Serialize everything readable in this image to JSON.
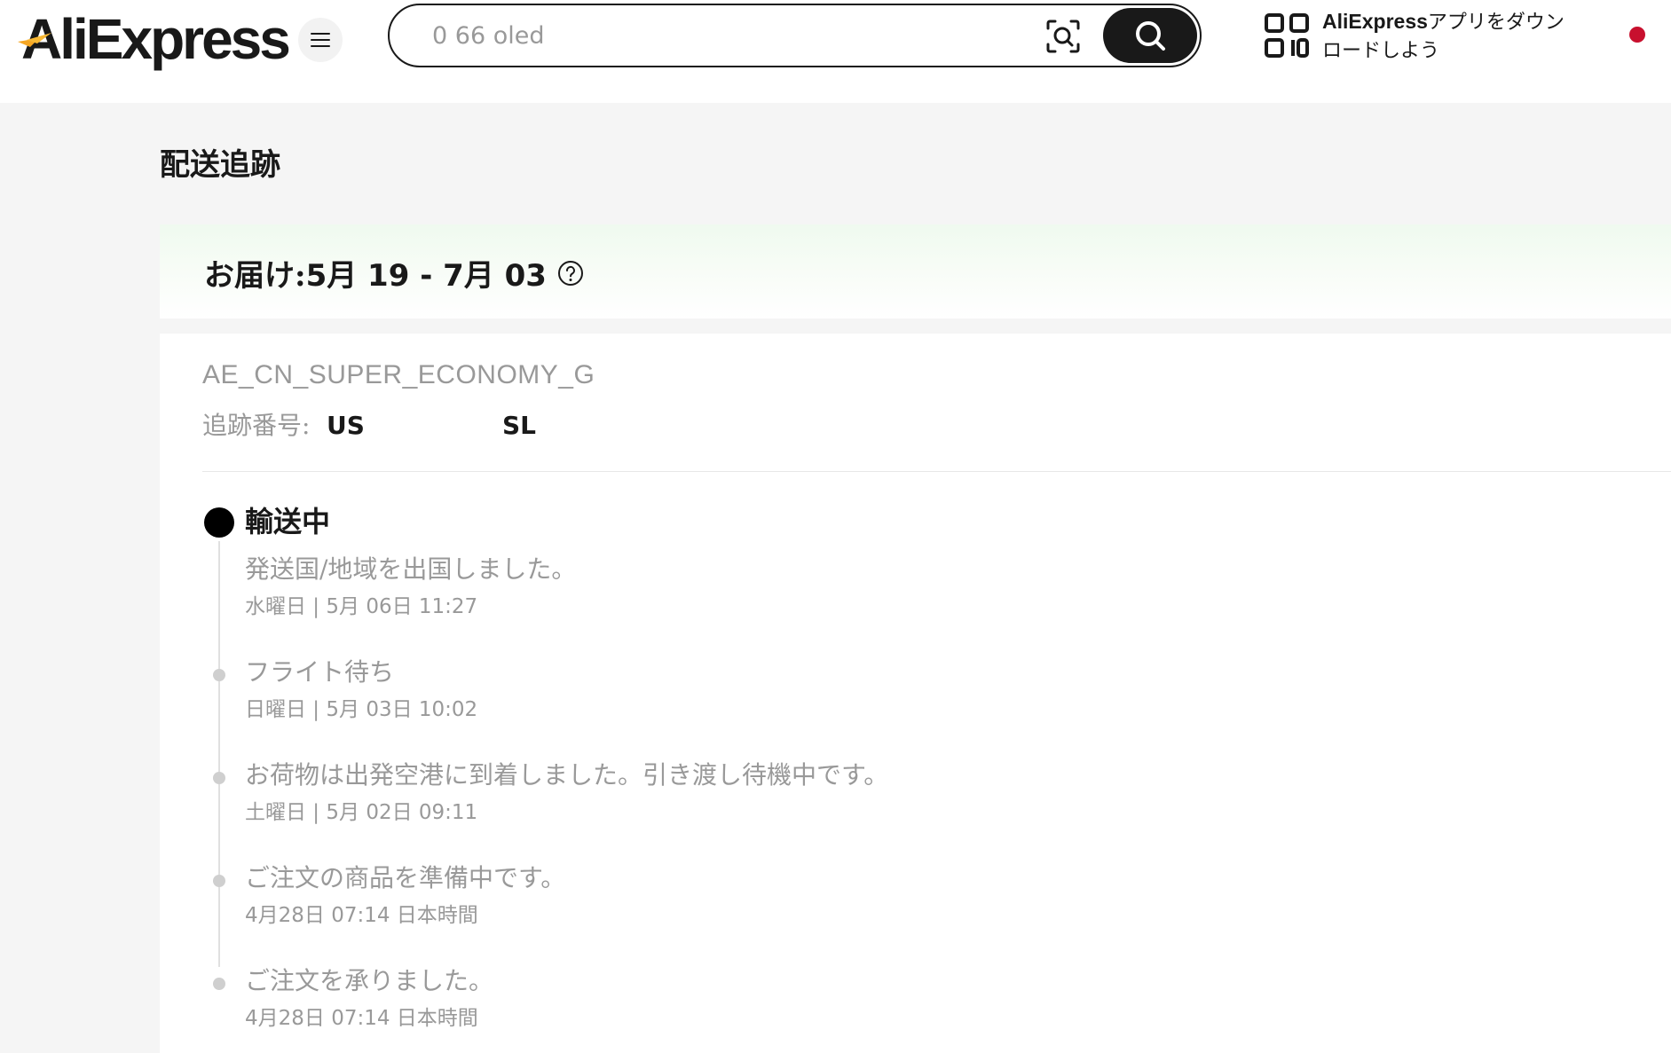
{
  "header": {
    "logo_text": "AliExpress",
    "search": {
      "placeholder": "0 66 oled"
    },
    "app_promo": {
      "brand": "AliExpress",
      "line1_rest": "アプリをダウン",
      "line2": "ロードしよう"
    },
    "colors": {
      "accent": "#f5a623",
      "brand_dark": "#191919",
      "flag": "#c8102e"
    }
  },
  "page": {
    "title": "配送追跡"
  },
  "delivery": {
    "label": "お届け:",
    "dates": "5月 19 - 7月 03"
  },
  "tracking": {
    "carrier": "AE_CN_SUPER_ECONOMY_G",
    "number_label": "追跡番号:",
    "number_prefix": "US",
    "number_suffix": "SL",
    "status": "輸送中",
    "events": [
      {
        "description": "発送国/地域を出国しました。",
        "time": "水曜日 | 5月 06日 11:27"
      },
      {
        "description": "フライト待ち",
        "time": "日曜日 | 5月 03日 10:02"
      },
      {
        "description": "お荷物は出発空港に到着しました。引き渡し待機中です。",
        "time": "土曜日 | 5月 02日 09:11"
      },
      {
        "description": "ご注文の商品を準備中です。",
        "time": "4月28日 07:14 日本時間"
      },
      {
        "description": "ご注文を承りました。",
        "time": "4月28日 07:14 日本時間"
      }
    ]
  },
  "icons": {
    "menu": "hamburger-icon",
    "camera": "image-search-icon",
    "search": "search-icon",
    "qr": "qr-code-icon",
    "help": "question-circle-icon"
  }
}
